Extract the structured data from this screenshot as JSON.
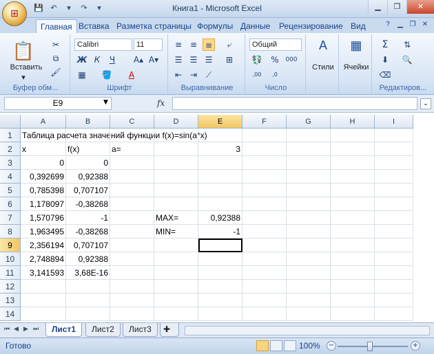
{
  "window": {
    "title": "Книга1 - Microsoft Excel"
  },
  "tabs": [
    "Главная",
    "Вставка",
    "Разметка страницы",
    "Формулы",
    "Данные",
    "Рецензирование",
    "Вид"
  ],
  "ribbon": {
    "clipboard": {
      "paste_label": "Вставить",
      "group_label": "Буфер обм..."
    },
    "font": {
      "name": "Calibri",
      "size": "11",
      "bold": "Ж",
      "italic": "К",
      "underline": "Ч",
      "group_label": "Шрифт"
    },
    "alignment": {
      "group_label": "Выравнивание"
    },
    "number": {
      "format": "Общий",
      "group_label": "Число"
    },
    "styles": {
      "label": "Стили"
    },
    "cells": {
      "label": "Ячейки"
    },
    "editing": {
      "group_label": "Редактиров..."
    }
  },
  "formula_bar": {
    "name_box": "E9",
    "fx": "fx",
    "formula": ""
  },
  "grid": {
    "columns": [
      "A",
      "B",
      "C",
      "D",
      "E",
      "F",
      "G",
      "H",
      "I"
    ],
    "rows": [
      "1",
      "2",
      "3",
      "4",
      "5",
      "6",
      "7",
      "8",
      "9",
      "10",
      "11",
      "12",
      "13",
      "14"
    ],
    "selected_column": "E",
    "selected_row": "9",
    "cells": {
      "A1": "Таблица расчета значений функции f(x)=sin(a*x)",
      "A2": "x",
      "B2": "f(x)",
      "C2": "a=",
      "E2": "3",
      "A3": "0",
      "B3": "0",
      "A4": "0,392699",
      "B4": "0,92388",
      "A5": "0,785398",
      "B5": "0,707107",
      "A6": "1,178097",
      "B6": "-0,38268",
      "A7": "1,570796",
      "B7": "-1",
      "D7": "MAX=",
      "E7": "0,92388",
      "A8": "1,963495",
      "B8": "-0,38268",
      "D8": "MIN=",
      "E8": "-1",
      "A9": "2,356194",
      "B9": "0,707107",
      "A10": "2,748894",
      "B10": "0,92388",
      "A11": "3,141593",
      "B11": "3,68E-16"
    }
  },
  "sheets": [
    "Лист1",
    "Лист2",
    "Лист3"
  ],
  "status": {
    "ready": "Готово",
    "zoom": "100%"
  }
}
